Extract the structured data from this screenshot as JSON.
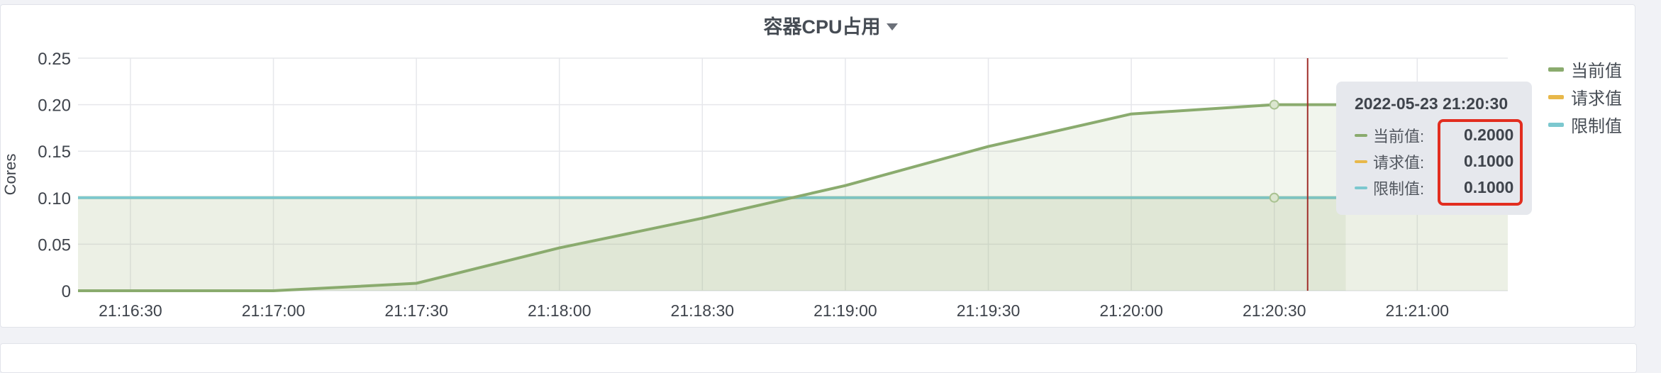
{
  "panel": {
    "title": "容器CPU占用"
  },
  "chart_data": {
    "type": "area",
    "ylabel": "Cores",
    "ylim": [
      0,
      0.25
    ],
    "y_ticks": [
      "0",
      "0.05",
      "0.10",
      "0.15",
      "0.20",
      "0.25"
    ],
    "y_tick_values": [
      0,
      0.05,
      0.1,
      0.15,
      0.2,
      0.25
    ],
    "x_ticks": [
      "21:16:30",
      "21:17:00",
      "21:17:30",
      "21:18:00",
      "21:18:30",
      "21:19:00",
      "21:19:30",
      "21:20:00",
      "21:20:30",
      "21:21:00"
    ],
    "x_tick_values": [
      "21:16:30",
      "21:17:00",
      "21:17:30",
      "21:18:00",
      "21:18:30",
      "21:19:00",
      "21:19:30",
      "21:20:00",
      "21:20:30",
      "21:21:00"
    ],
    "xlim": [
      "21:16:19",
      "21:21:19"
    ],
    "grid": true,
    "legend_position": "right",
    "series": [
      {
        "name": "当前值",
        "color": "#8aab6e",
        "x": [
          "21:16:19",
          "21:17:00",
          "21:17:30",
          "21:18:00",
          "21:18:30",
          "21:19:00",
          "21:19:30",
          "21:20:00",
          "21:20:30",
          "21:20:45"
        ],
        "values": [
          0,
          0,
          0.008,
          0.046,
          0.078,
          0.113,
          0.155,
          0.19,
          0.2,
          0.2
        ]
      },
      {
        "name": "请求值",
        "color": "#e8b84a",
        "x": [
          "21:16:19",
          "21:21:19"
        ],
        "values": [
          0.1,
          0.1
        ]
      },
      {
        "name": "限制值",
        "color": "#7cc8cf",
        "x": [
          "21:16:19",
          "21:21:19"
        ],
        "values": [
          0.1,
          0.1
        ]
      }
    ],
    "cursor_x": "21:20:37",
    "hover_x": "21:20:30"
  },
  "tooltip": {
    "timestamp": "2022-05-23 21:20:30",
    "rows": [
      {
        "label": "当前值:",
        "value": "0.2000",
        "color": "#8aab6e"
      },
      {
        "label": "请求值:",
        "value": "0.1000",
        "color": "#e8b84a"
      },
      {
        "label": "限制值:",
        "value": "0.1000",
        "color": "#7cc8cf"
      }
    ]
  },
  "colors": {
    "highlight_box": "#e22d1f",
    "cursor_line": "#a02e2a"
  }
}
